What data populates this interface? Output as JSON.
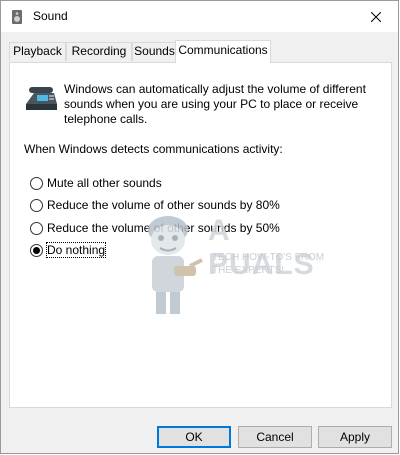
{
  "window": {
    "title": "Sound",
    "title_icon": "speaker-icon",
    "close_icon": "close-icon"
  },
  "tabs": [
    {
      "label": "Playback",
      "active": false
    },
    {
      "label": "Recording",
      "active": false
    },
    {
      "label": "Sounds",
      "active": false
    },
    {
      "label": "Communications",
      "active": true
    }
  ],
  "communications": {
    "icon": "telephone-icon",
    "description": "Windows can automatically adjust the volume of different sounds when you are using your PC to place or receive telephone calls.",
    "detect_label": "When Windows detects communications activity:",
    "options": [
      {
        "label": "Mute all other sounds",
        "checked": false
      },
      {
        "label": "Reduce the volume of other sounds by 80%",
        "checked": false
      },
      {
        "label": "Reduce the volume of other sounds by 50%",
        "checked": false
      },
      {
        "label": "Do nothing",
        "checked": true
      }
    ]
  },
  "watermark": {
    "logo": "A PUALS",
    "tagline_1": "TECH HOW-TO'S FROM",
    "tagline_2": "THE EXPERTS!"
  },
  "buttons": {
    "ok": "OK",
    "cancel": "Cancel",
    "apply": "Apply"
  }
}
